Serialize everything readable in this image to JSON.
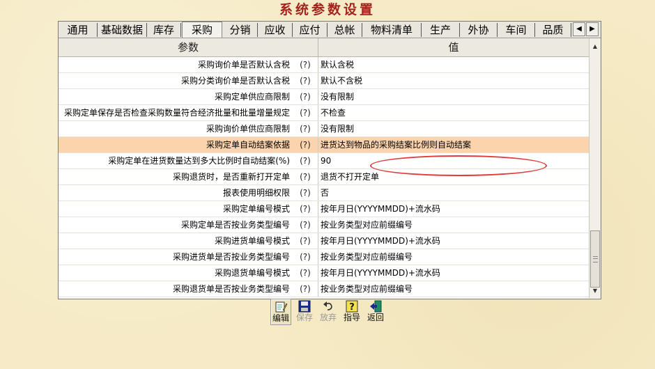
{
  "window": {
    "title": "系统参数设置"
  },
  "tabs": [
    {
      "label": "通用"
    },
    {
      "label": "基础数据"
    },
    {
      "label": "库存"
    },
    {
      "label": "采购"
    },
    {
      "label": "分销"
    },
    {
      "label": "应收"
    },
    {
      "label": "应付"
    },
    {
      "label": "总帐"
    },
    {
      "label": "物料清单"
    },
    {
      "label": "生产"
    },
    {
      "label": "外协"
    },
    {
      "label": "车间"
    },
    {
      "label": "品质"
    }
  ],
  "active_tab": "采购",
  "tab_scroll": {
    "left_icon": "arrow-left-icon",
    "right_icon": "arrow-right-icon",
    "left": "◀",
    "right": "▶"
  },
  "table": {
    "headers": {
      "param": "参数",
      "value": "值"
    },
    "help_mark": "(?)",
    "rows": [
      {
        "param": "采购询价单是否默认含税",
        "value": "默认含税"
      },
      {
        "param": "采购分类询价单是否默认含税",
        "value": "默认不含税"
      },
      {
        "param": "采购定单供应商限制",
        "value": "没有限制"
      },
      {
        "param": "采购定单保存是否检查采购数量符合经济批量和批量增量规定",
        "value": "不检查"
      },
      {
        "param": "采购询价单供应商限制",
        "value": "没有限制"
      },
      {
        "param": "采购定单自动结案依据",
        "value": "进货达到物品的采购结案比例则自动结案"
      },
      {
        "param": "采购定单在进货数量达到多大比例时自动结案(%)",
        "value": "90"
      },
      {
        "param": "采购退货时，是否重新打开定单",
        "value": "退货不打开定单"
      },
      {
        "param": "报表使用明细权限",
        "value": "否"
      },
      {
        "param": "采购定单编号模式",
        "value": "按年月日(YYYYMMDD)+流水码"
      },
      {
        "param": "采购定单是否按业务类型编号",
        "value": "按业务类型对应前缀编号"
      },
      {
        "param": "采购进货单编号模式",
        "value": "按年月日(YYYYMMDD)+流水码"
      },
      {
        "param": "采购进货单是否按业务类型编号",
        "value": "按业务类型对应前缀编号"
      },
      {
        "param": "采购退货单编号模式",
        "value": "按年月日(YYYYMMDD)+流水码"
      },
      {
        "param": "采购退货单是否按业务类型编号",
        "value": "按业务类型对应前缀编号"
      }
    ],
    "selected_index": 5
  },
  "scrollbar": {
    "up": "▲",
    "down": "▼"
  },
  "toolbar": {
    "edit": {
      "label": "编辑",
      "icon": "edit-icon"
    },
    "save": {
      "label": "保存",
      "icon": "save-icon"
    },
    "discard": {
      "label": "放弃",
      "icon": "undo-icon"
    },
    "guide": {
      "label": "指导",
      "icon": "help-icon"
    },
    "back": {
      "label": "返回",
      "icon": "exit-icon"
    }
  },
  "colors": {
    "title": "#a3241d",
    "selected_row": "#fbd3ad",
    "annotation": "#e23b3b",
    "background": "#f6ebc6"
  }
}
